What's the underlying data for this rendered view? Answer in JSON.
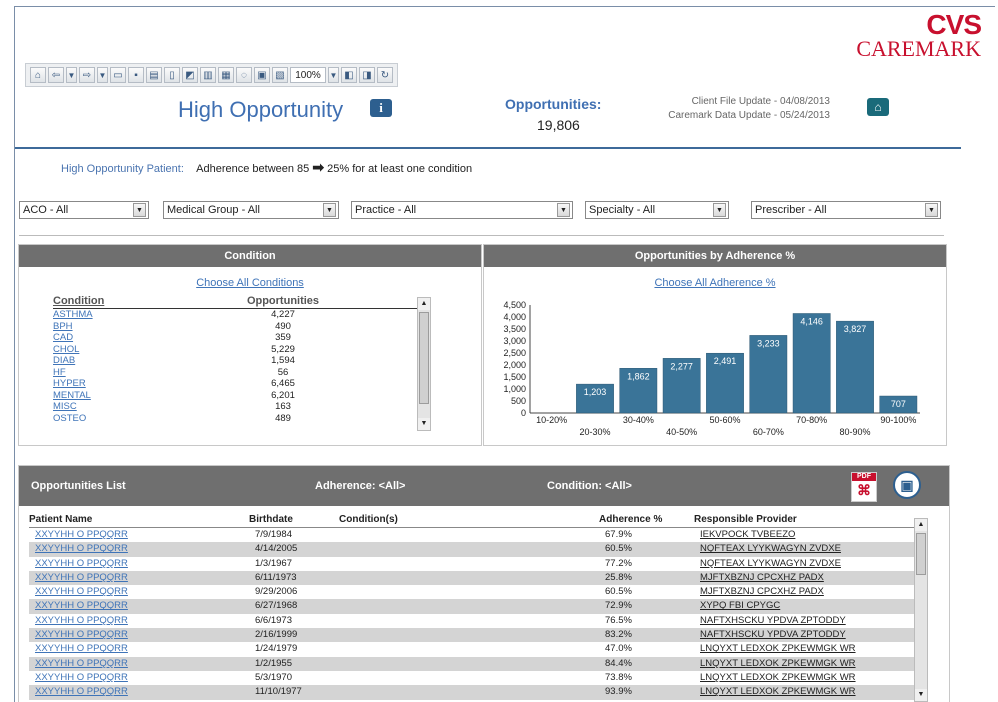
{
  "logo": {
    "line1": "CVS",
    "line2": "CAREMARK"
  },
  "toolbar": {
    "zoom": "100%"
  },
  "header": {
    "title": "High Opportunity",
    "opportunities_label": "Opportunities:",
    "opportunities_count": "19,806",
    "client_file_update": "Client File Update -  04/08/2013",
    "caremark_data_update": "Caremark Data Update -  05/24/2013"
  },
  "hop": {
    "label": "High Opportunity Patient:",
    "text_before": "Adherence between  85",
    "text_after": "25% for at least one condition"
  },
  "filters": [
    "ACO - All",
    "Medical Group - All",
    "Practice - All",
    "Specialty - All",
    "Prescriber - All"
  ],
  "condition_panel": {
    "title": "Condition",
    "choose_link": "Choose All Conditions",
    "col_condition": "Condition",
    "col_opportunities": "Opportunities",
    "rows": [
      {
        "name": "ASTHMA",
        "value": "4,227"
      },
      {
        "name": "BPH",
        "value": "490"
      },
      {
        "name": "CAD",
        "value": "359"
      },
      {
        "name": "CHOL",
        "value": "5,229"
      },
      {
        "name": "DIAB",
        "value": "1,594"
      },
      {
        "name": "HF",
        "value": "56"
      },
      {
        "name": "HYPER",
        "value": "6,465"
      },
      {
        "name": "MENTAL",
        "value": "6,201"
      },
      {
        "name": "MISC",
        "value": "163"
      },
      {
        "name": "OSTEO",
        "value": "489"
      }
    ]
  },
  "adherence_panel": {
    "title": "Opportunities by Adherence %",
    "choose_link": "Choose All Adherence %"
  },
  "chart_data": {
    "type": "bar",
    "title": "Opportunities by Adherence %",
    "categories": [
      "10-20%",
      "20-30%",
      "30-40%",
      "40-50%",
      "50-60%",
      "60-70%",
      "70-80%",
      "80-90%",
      "90-100%"
    ],
    "values": [
      0,
      1203,
      1862,
      2277,
      2491,
      3233,
      4146,
      3827,
      707
    ],
    "data_labels": [
      "",
      "1,203",
      "1,862",
      "2,277",
      "2,491",
      "3,233",
      "4,146",
      "3,827",
      "707"
    ],
    "yticks": [
      "0",
      "500",
      "1,000",
      "1,500",
      "2,000",
      "2,500",
      "3,000",
      "3,500",
      "4,000",
      "4,500"
    ],
    "ylim": [
      0,
      4500
    ],
    "color": "#3a7498"
  },
  "list": {
    "title": "Opportunities  List",
    "adherence_filter": "Adherence: <All>",
    "condition_filter": "Condition: <All>",
    "pdf_label": "PDF",
    "columns": [
      "Patient Name",
      "Birthdate",
      "Condition(s)",
      "Adherence %",
      "Responsible Provider"
    ],
    "rows": [
      {
        "name": "XXYYHH O PPQQRR",
        "birth": "7/9/1984",
        "adh": "67.9%",
        "prov": "IEKVPOCK TVBEEZO"
      },
      {
        "name": "XXYYHH O PPQQRR",
        "birth": "4/14/2005",
        "adh": "60.5%",
        "prov": "NQFTEAX LYYKWAGYN ZVDXE"
      },
      {
        "name": "XXYYHH O PPQQRR",
        "birth": "1/3/1967",
        "adh": "77.2%",
        "prov": "NQFTEAX LYYKWAGYN ZVDXE"
      },
      {
        "name": "XXYYHH O PPQQRR",
        "birth": "6/11/1973",
        "adh": "25.8%",
        "prov": "MJFTXBZNJ CPCXHZ PADX"
      },
      {
        "name": "XXYYHH O PPQQRR",
        "birth": "9/29/2006",
        "adh": "60.5%",
        "prov": "MJFTXBZNJ CPCXHZ PADX"
      },
      {
        "name": "XXYYHH O PPQQRR",
        "birth": "6/27/1968",
        "adh": "72.9%",
        "prov": "XYPQ FBI CPYGC"
      },
      {
        "name": "XXYYHH O PPQQRR",
        "birth": "6/6/1973",
        "adh": "76.5%",
        "prov": "NAFTXHSCKU YPDVA ZPTODDY"
      },
      {
        "name": "XXYYHH O PPQQRR",
        "birth": "2/16/1999",
        "adh": "83.2%",
        "prov": "NAFTXHSCKU YPDVA ZPTODDY"
      },
      {
        "name": "XXYYHH O PPQQRR",
        "birth": "1/24/1979",
        "adh": "47.0%",
        "prov": "LNQYXT LEDXOK ZPKEWMGK WR"
      },
      {
        "name": "XXYYHH O PPQQRR",
        "birth": "1/2/1955",
        "adh": "84.4%",
        "prov": "LNQYXT LEDXOK ZPKEWMGK WR"
      },
      {
        "name": "XXYYHH O PPQQRR",
        "birth": "5/3/1970",
        "adh": "73.8%",
        "prov": "LNQYXT LEDXOK ZPKEWMGK WR"
      },
      {
        "name": "XXYYHH O PPQQRR",
        "birth": "11/10/1977",
        "adh": "93.9%",
        "prov": "LNQYXT LEDXOK ZPKEWMGK WR"
      }
    ]
  }
}
